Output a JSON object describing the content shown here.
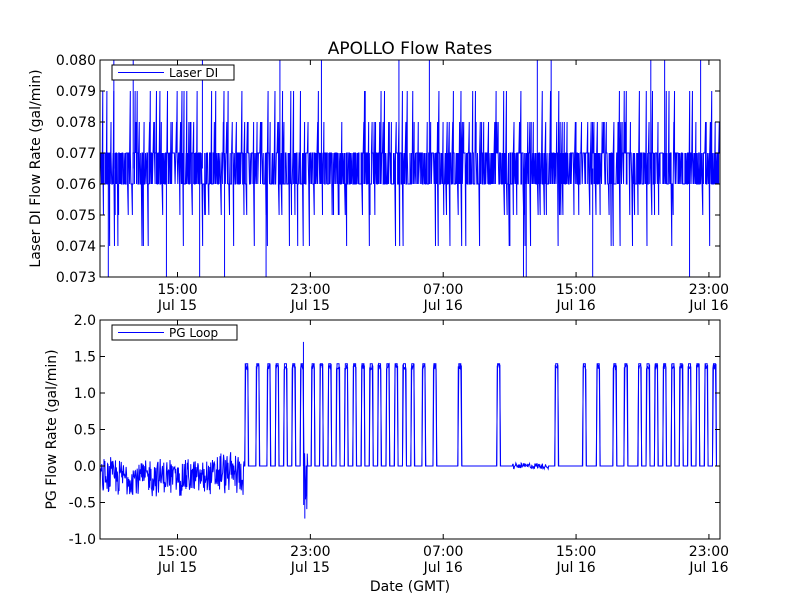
{
  "figure": {
    "title": "APOLLO Flow Rates",
    "xlabel": "Date (GMT)"
  },
  "chart_data": [
    {
      "type": "line",
      "ylabel": "Laser DI Flow Rate (gal/min)",
      "ylim": [
        0.073,
        0.08
      ],
      "yticks": [
        0.073,
        0.074,
        0.075,
        0.076,
        0.077,
        0.078,
        0.079,
        0.08
      ],
      "ytick_labels": [
        "0.073",
        "0.074",
        "0.075",
        "0.076",
        "0.077",
        "0.078",
        "0.079",
        "0.080"
      ],
      "xlim": [
        "2015-07-15T10:20",
        "2015-07-16T23:40"
      ],
      "xticks": [
        {
          "t": "2015-07-15T15:00",
          "time": "15:00",
          "date": "Jul 15"
        },
        {
          "t": "2015-07-15T23:00",
          "time": "23:00",
          "date": "Jul 15"
        },
        {
          "t": "2015-07-16T07:00",
          "time": "07:00",
          "date": "Jul 16"
        },
        {
          "t": "2015-07-16T15:00",
          "time": "15:00",
          "date": "Jul 16"
        },
        {
          "t": "2015-07-16T23:00",
          "time": "23:00",
          "date": "Jul 16"
        }
      ],
      "grid": false,
      "legend_position": "top-left",
      "series": [
        {
          "name": "Laser DI",
          "color": "#0000ff",
          "base_range": [
            0.076,
            0.077
          ],
          "t": [
            "2015-07-15T10:20",
            "2015-07-15T12:00",
            "2015-07-15T14:00",
            "2015-07-15T16:00",
            "2015-07-15T18:00",
            "2015-07-15T20:00",
            "2015-07-15T22:00",
            "2015-07-16T00:00",
            "2015-07-16T02:00",
            "2015-07-16T04:00",
            "2015-07-16T06:00",
            "2015-07-16T08:00",
            "2015-07-16T10:00",
            "2015-07-16T12:00",
            "2015-07-16T14:00",
            "2015-07-16T16:00",
            "2015-07-16T18:00",
            "2015-07-16T20:00",
            "2015-07-16T22:00",
            "2015-07-16T23:40"
          ],
          "y": [
            0.0765,
            0.0766,
            0.0765,
            0.0766,
            0.0765,
            0.0766,
            0.0765,
            0.0766,
            0.0765,
            0.0766,
            0.0765,
            0.0766,
            0.0765,
            0.0766,
            0.0765,
            0.0766,
            0.0765,
            0.0766,
            0.0765,
            0.0766
          ],
          "spikes_high": [
            {
              "t": "2015-07-15T11:10",
              "y": 0.08
            },
            {
              "t": "2015-07-15T12:20",
              "y": 0.08
            },
            {
              "t": "2015-07-15T16:30",
              "y": 0.08
            },
            {
              "t": "2015-07-15T21:10",
              "y": 0.08
            },
            {
              "t": "2015-07-15T23:40",
              "y": 0.08
            },
            {
              "t": "2015-07-16T04:20",
              "y": 0.08
            },
            {
              "t": "2015-07-16T06:10",
              "y": 0.08
            },
            {
              "t": "2015-07-16T12:40",
              "y": 0.08
            },
            {
              "t": "2015-07-16T13:30",
              "y": 0.08
            },
            {
              "t": "2015-07-16T19:30",
              "y": 0.08
            },
            {
              "t": "2015-07-16T20:20",
              "y": 0.08
            },
            {
              "t": "2015-07-16T22:30",
              "y": 0.08
            }
          ],
          "spikes_low": [
            {
              "t": "2015-07-15T10:50",
              "y": 0.073
            },
            {
              "t": "2015-07-15T14:20",
              "y": 0.073
            },
            {
              "t": "2015-07-15T16:20",
              "y": 0.073
            },
            {
              "t": "2015-07-15T17:50",
              "y": 0.073
            },
            {
              "t": "2015-07-15T20:20",
              "y": 0.073
            },
            {
              "t": "2015-07-16T11:50",
              "y": 0.073
            },
            {
              "t": "2015-07-16T12:00",
              "y": 0.073
            },
            {
              "t": "2015-07-16T16:00",
              "y": 0.073
            },
            {
              "t": "2015-07-16T21:50",
              "y": 0.073
            }
          ]
        }
      ]
    },
    {
      "type": "line",
      "ylabel": "PG Flow Rate (gal/min)",
      "ylim": [
        -1.0,
        2.0
      ],
      "yticks": [
        -1.0,
        -0.5,
        0.0,
        0.5,
        1.0,
        1.5,
        2.0
      ],
      "ytick_labels": [
        "-1.0",
        "-0.5",
        "0.0",
        "0.5",
        "1.0",
        "1.5",
        "2.0"
      ],
      "xlim": [
        "2015-07-15T10:20",
        "2015-07-16T23:40"
      ],
      "xticks": [
        {
          "t": "2015-07-15T15:00",
          "time": "15:00",
          "date": "Jul 15"
        },
        {
          "t": "2015-07-15T23:00",
          "time": "23:00",
          "date": "Jul 15"
        },
        {
          "t": "2015-07-16T07:00",
          "time": "07:00",
          "date": "Jul 16"
        },
        {
          "t": "2015-07-16T15:00",
          "time": "15:00",
          "date": "Jul 16"
        },
        {
          "t": "2015-07-16T23:00",
          "time": "23:00",
          "date": "Jul 16"
        }
      ],
      "grid": false,
      "legend_position": "top-left",
      "series": [
        {
          "name": "PG Loop",
          "color": "#0000ff",
          "noise_segments": [
            {
              "t_start": "2015-07-15T10:20",
              "t_end": "2015-07-15T17:20",
              "center": -0.15,
              "amplitude": 0.3
            },
            {
              "t_start": "2015-07-15T17:20",
              "t_end": "2015-07-15T19:00",
              "center": -0.1,
              "amplitude": 0.35
            },
            {
              "t_start": "2015-07-15T22:30",
              "t_end": "2015-07-15T22:50",
              "center": -0.2,
              "amplitude": 0.5
            },
            {
              "t_start": "2015-07-16T11:10",
              "t_end": "2015-07-16T13:20",
              "center": 0.0,
              "amplitude": 0.05
            }
          ],
          "baseline": 0.0,
          "pulse_peak": 1.4,
          "max_spike": {
            "t": "2015-07-15T22:35",
            "y": 1.7
          },
          "min_spike": {
            "t": "2015-07-15T22:40",
            "y": -0.72
          },
          "pulse_times": [
            "2015-07-15T19:10",
            "2015-07-15T19:50",
            "2015-07-15T20:30",
            "2015-07-15T21:00",
            "2015-07-15T21:30",
            "2015-07-15T22:00",
            "2015-07-15T22:30",
            "2015-07-15T23:10",
            "2015-07-15T23:40",
            "2015-07-16T00:10",
            "2015-07-16T00:40",
            "2015-07-16T01:10",
            "2015-07-16T01:40",
            "2015-07-16T02:10",
            "2015-07-16T02:40",
            "2015-07-16T03:10",
            "2015-07-16T03:40",
            "2015-07-16T04:10",
            "2015-07-16T04:40",
            "2015-07-16T05:10",
            "2015-07-16T05:50",
            "2015-07-16T06:30",
            "2015-07-16T08:00",
            "2015-07-16T10:20",
            "2015-07-16T13:50",
            "2015-07-16T15:30",
            "2015-07-16T16:20",
            "2015-07-16T17:20",
            "2015-07-16T18:00",
            "2015-07-16T18:50",
            "2015-07-16T19:20",
            "2015-07-16T19:50",
            "2015-07-16T20:20",
            "2015-07-16T20:50",
            "2015-07-16T21:20",
            "2015-07-16T21:50",
            "2015-07-16T22:20",
            "2015-07-16T22:50",
            "2015-07-16T23:20"
          ]
        }
      ]
    }
  ]
}
